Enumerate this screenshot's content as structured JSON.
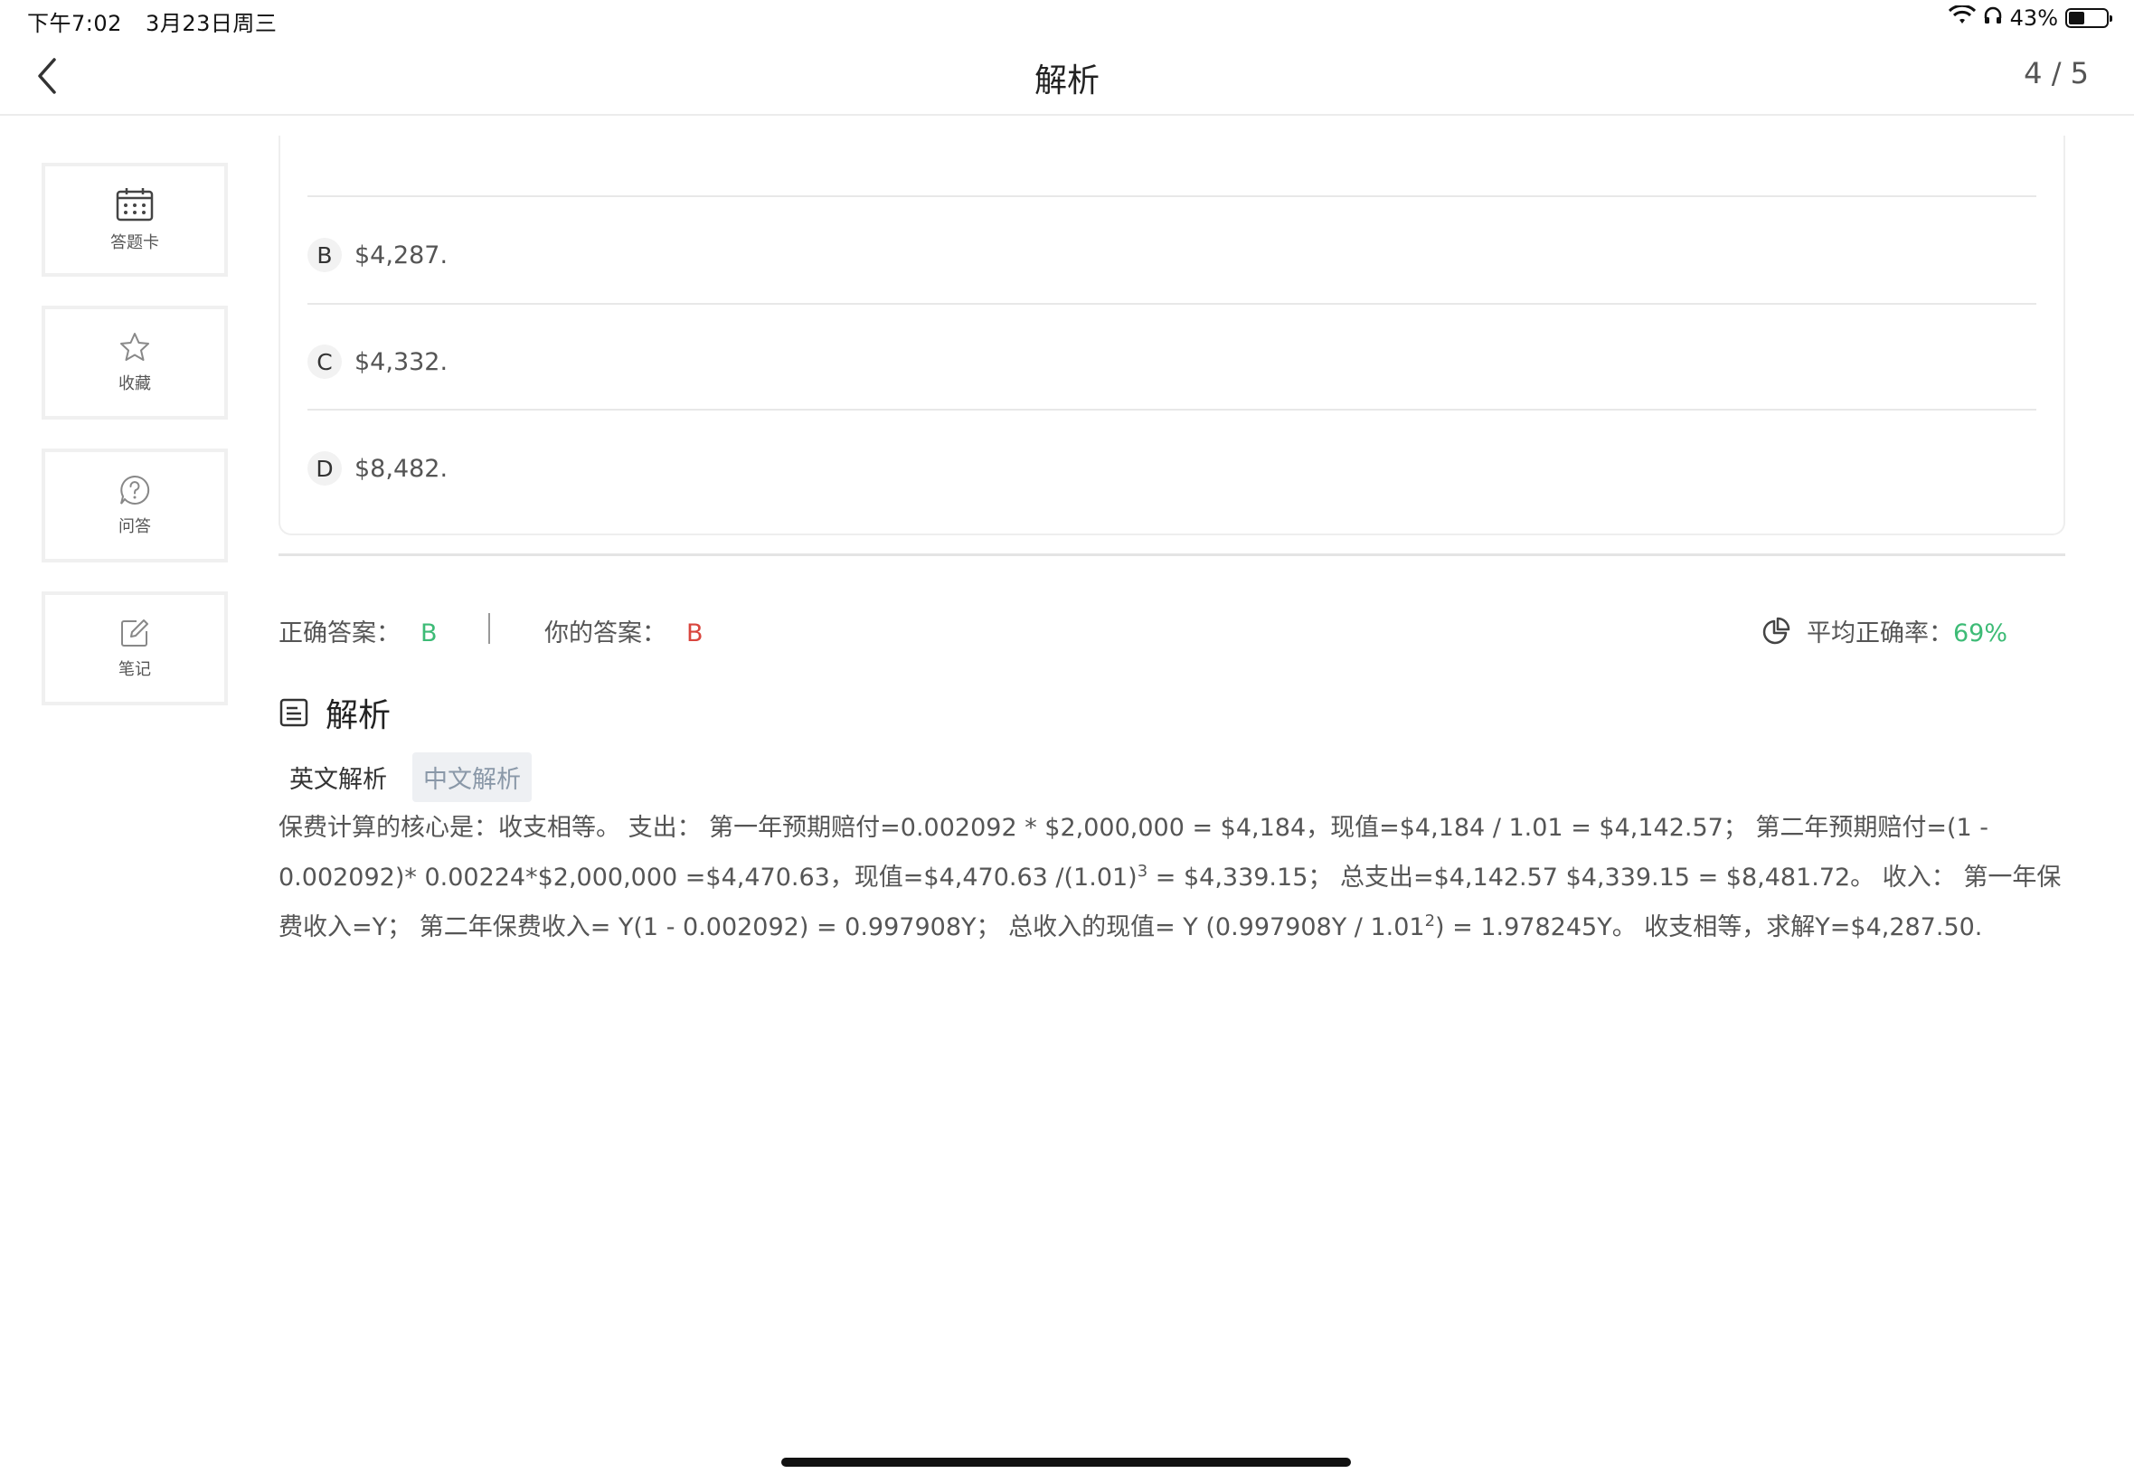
{
  "status": {
    "time": "下午7:02",
    "date": "3月23日周三",
    "battery": "43%",
    "battery_level": 0.43
  },
  "nav": {
    "title": "解析",
    "count": "4 / 5"
  },
  "sidebar": [
    {
      "label": "答题卡",
      "icon": "answer-card-icon"
    },
    {
      "label": "收藏",
      "icon": "star-icon"
    },
    {
      "label": "问答",
      "icon": "question-icon"
    },
    {
      "label": "笔记",
      "icon": "note-edit-icon"
    }
  ],
  "options": [
    {
      "letter": "B",
      "text": "$4,287."
    },
    {
      "letter": "C",
      "text": "$4,332."
    },
    {
      "letter": "D",
      "text": "$8,482."
    }
  ],
  "answer": {
    "correct_label": "正确答案：",
    "correct_value": "B",
    "yours_label": "你的答案：",
    "yours_value": "B",
    "rate_label": "平均正确率：",
    "rate_value": "69%"
  },
  "explanation": {
    "title": "解析",
    "tabs": [
      "英文解析",
      "中文解析"
    ],
    "active_tab": "中文解析",
    "body_1": "保费计算的核心是：收支相等。 支出： 第一年预期赔付=0.002092 * $2,000,000 = $4,184，现值=$4,184 / 1.01 = $4,142.57； 第二年预期赔付=(1 - 0.002092)* 0.00224*$2,000,000 =$4,470.63，现值=$4,470.63 /(1.01)",
    "sup_1": "3",
    "body_2": " = $4,339.15； 总支出=$4,142.57 $4,339.15 = $8,481.72。 收入： 第一年保费收入=Y； 第二年保费收入= Y(1 - 0.002092) = 0.997908Y； 总收入的现值= Y (0.997908Y / 1.01",
    "sup_2": "2",
    "body_3": ") = 1.978245Y。 收支相等，求解Y=$4,287.50."
  },
  "colors": {
    "correct": "#3dbb76",
    "wrong": "#d9463e",
    "tab_active_bg": "#eef0f3"
  }
}
